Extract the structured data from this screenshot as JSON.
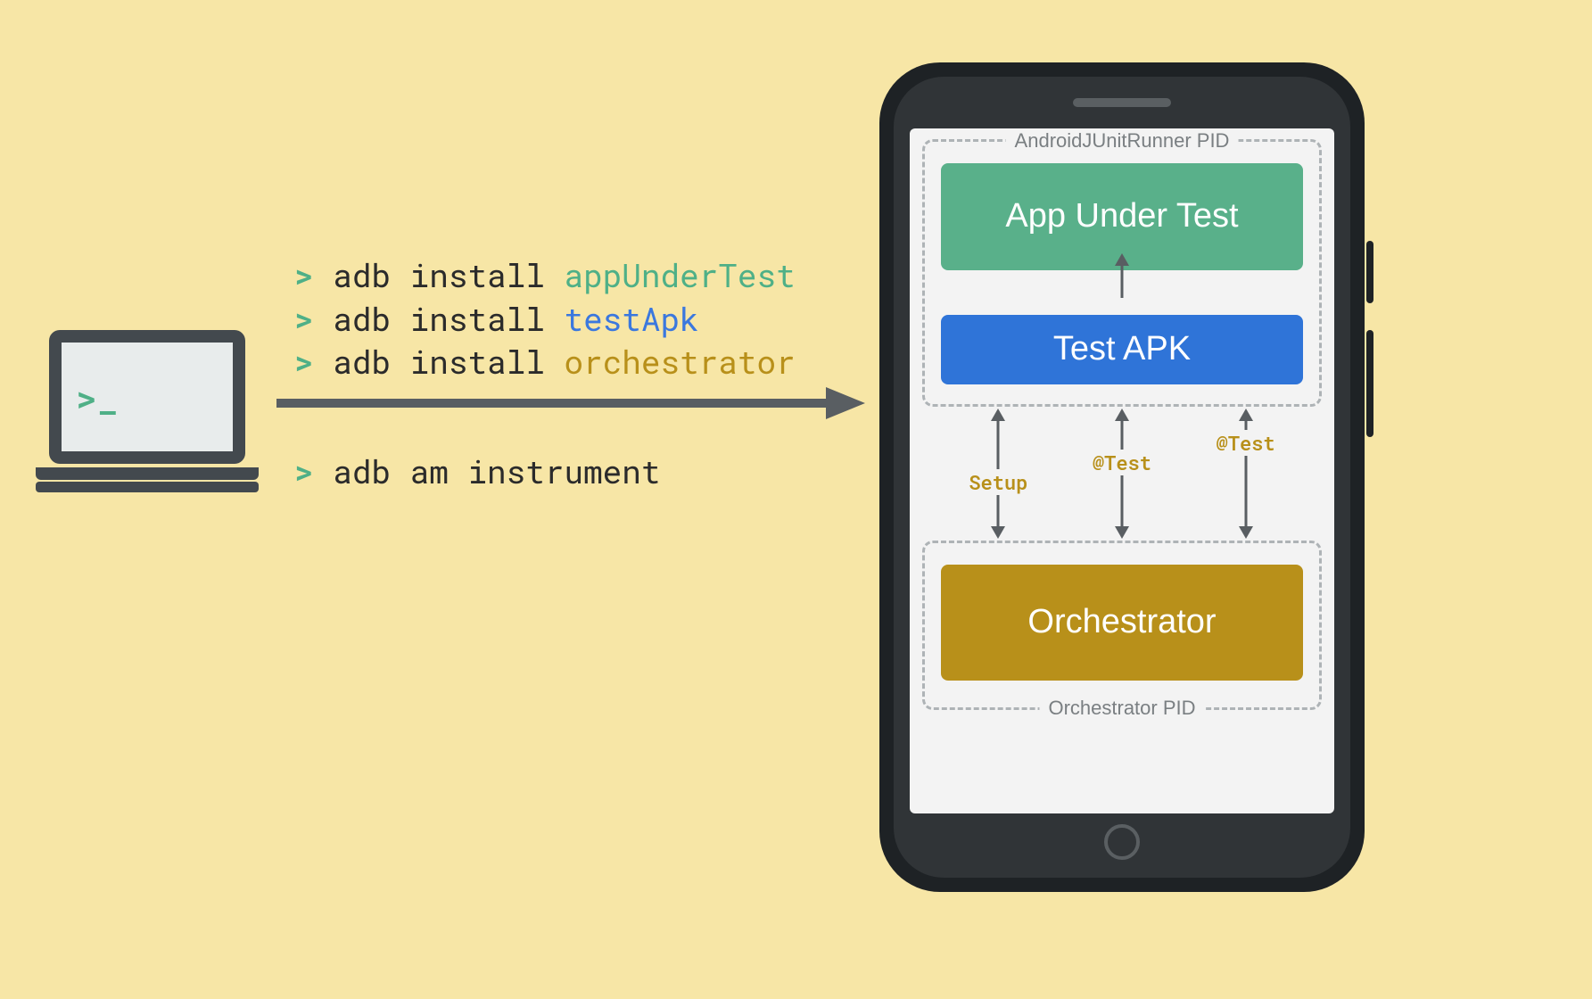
{
  "laptop": {
    "prompt": ">_"
  },
  "commands": {
    "lines": [
      {
        "chev": ">",
        "cmd": "adb install",
        "arg": "appUnderTest",
        "argClass": "green"
      },
      {
        "chev": ">",
        "cmd": "adb install",
        "arg": "testApk",
        "argClass": "blue"
      },
      {
        "chev": ">",
        "cmd": "adb install",
        "arg": "orchestrator",
        "argClass": "yellow"
      }
    ],
    "run": {
      "chev": ">",
      "cmd": "adb am instrument"
    }
  },
  "phone": {
    "runnerPid": {
      "label": "AndroidJUnitRunner PID",
      "appUnderTest": "App Under Test",
      "testApk": "Test APK"
    },
    "arrows": {
      "labels": [
        "Setup",
        "@Test",
        "@Test"
      ]
    },
    "orchestratorPid": {
      "label": "Orchestrator PID",
      "orchestrator": "Orchestrator"
    }
  },
  "colors": {
    "green": "#59b08a",
    "blue": "#2f74d8",
    "yellow": "#b8901a",
    "dark": "#43494e",
    "bg": "#f7e6a6"
  }
}
